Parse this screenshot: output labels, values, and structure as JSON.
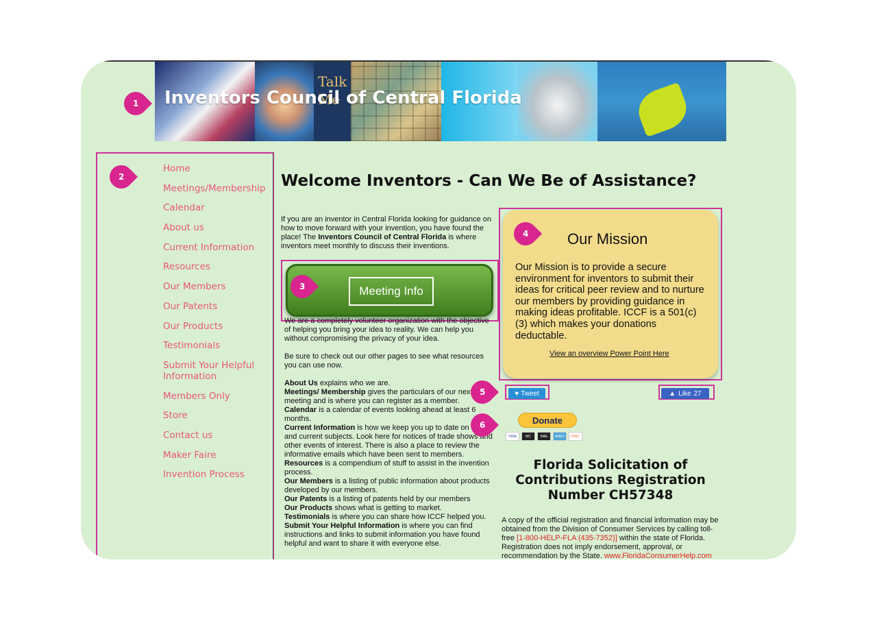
{
  "header": {
    "title": "Inventors Council of Central Florida",
    "banner_text": "Talk Me"
  },
  "markers": [
    "1",
    "2",
    "3",
    "4",
    "5",
    "6"
  ],
  "nav": {
    "items": [
      "Home",
      "Meetings/Membership",
      "Calendar",
      "About us",
      "Current Information",
      "Resources",
      "Our Members",
      "Our Patents",
      "Our Products",
      "Testimonials",
      "Submit Your Helpful Information",
      "Members Only",
      "Store",
      "Contact us",
      "Maker Faire",
      "Invention Process"
    ]
  },
  "main": {
    "heading": "Welcome Inventors - Can We Be of Assistance?",
    "intro": {
      "pre": " If you are an inventor in Central Florida looking for guidance on how to move forward with your invention, you have found the place!  The ",
      "bold": "Inventors Council of Central Florida",
      "post": " is where inventors meet monthly to discuss their inventions."
    },
    "meeting_button": "Meeting Info",
    "para1": "We are a completely volunteer organization with the objective of helping you bring your idea to reality.  We can help you without compromising the privacy of your idea.",
    "para2": "Be sure to check out our other pages to see what resources you can use now.",
    "list": [
      {
        "term": "About Us",
        "desc": " explains who we are."
      },
      {
        "term": "Meetings/ Membership",
        "desc": " gives the particulars of our next meeting and is where you can register as a member."
      },
      {
        "term": "Calendar",
        "desc": " is a calendar of events looking ahead at least 6 months."
      },
      {
        "term": "Current Information",
        "desc": " is how we keep you up to date on events and current subjects.  Look here for notices of trade shows and other events of interest.  There is also a place to review the informative emails which have been sent to members."
      },
      {
        "term": "Resources",
        "desc": " is a compendium of stuff to assist in the invention process."
      },
      {
        "term": "Our Members",
        "desc": " is a listing of public information about products developed by our members."
      },
      {
        "term": "Our Patents",
        "desc": " is a listing of patents held by our members"
      },
      {
        "term": "Our Products",
        "desc": " shows what is getting to market."
      },
      {
        "term": "Testimonials",
        "desc": " is where you can share how ICCF helped you."
      },
      {
        "term": "Submit Your Helpful Information",
        "desc": " is where you can find instructions and links to submit information you have found helpful and want to share it with everyone else."
      }
    ]
  },
  "mission": {
    "title": "Our Mission",
    "text": "Our Mission is to provide a secure environment for inventors to submit their ideas for critical peer review and to nurture our members by providing guidance in making ideas profitable. ICCF is a 501(c)(3) which makes your donations deductable.",
    "link": "View an overview Power Point Here"
  },
  "social": {
    "tweet": "Tweet",
    "like": "Like",
    "like_count": "27"
  },
  "donate": {
    "label": "Donate",
    "cards": [
      "VISA",
      "MC",
      "MAE",
      "AMEX",
      "DISC"
    ]
  },
  "registration": {
    "heading": "Florida Solicitation of Contributions Registration Number CH57348",
    "text_pre": "A copy of the official registration and financial information may be obtained from the Division of Consumer Services by calling toll-free ",
    "phone": "[1-800-HELP-FLA (435-7352)]",
    "text_mid": " within the state of Florida.  Registration does not imply endorsement, approval, or recommendation by the State.  ",
    "url": "www.FloridaConsumerHelp.com"
  },
  "colors": {
    "background": "#d9efd2",
    "link": "#e8557a",
    "marker": "#d9258f",
    "mission_bg": "#f2dc8c",
    "button": "#5a9e2f"
  }
}
